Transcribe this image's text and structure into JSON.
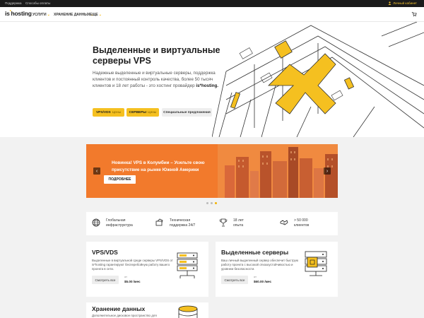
{
  "topbar": {
    "support": "Поддержка",
    "payment": "Способы оплаты",
    "account": "Личный кабинет"
  },
  "nav": {
    "logo_main": "is",
    "logo_sup": "*",
    "logo_rest": "hosting",
    "items": [
      "УСЛУГИ",
      "ХРАНЕНИЕ ДАННЫХ",
      "ЕЩЕ"
    ]
  },
  "hero": {
    "title_line1": "Выделенные и виртуальные",
    "title_line2": "серверы VPS",
    "desc": "Надежные выделенные и виртуальные серверы, поддержка клиентов и постоянный контроль качества, более 50 тысяч клиентов и 18 лет работы - это хостинг провайдер",
    "desc_brand": "is*hosting.",
    "btn_vps": "VPS/VDS",
    "btn_vps_sub": "Цены",
    "btn_servers": "СЕРВЕРЫ",
    "btn_servers_sub": "Цены",
    "btn_special": "Специальные предложения"
  },
  "banner": {
    "title": "Новинка! VPS в Колумбии – Усильте свою присутствие на рынке Южной Америки",
    "button": "ПОДРОБНЕЕ",
    "prev": "‹",
    "next": "›"
  },
  "features": [
    {
      "label1": "Глобальная",
      "label2": "инфраструктура",
      "icon": "globe-icon"
    },
    {
      "label1": "Техническая",
      "label2": "поддержка 24/7",
      "icon": "support-icon"
    },
    {
      "label1": "18 лет",
      "label2": "опыта",
      "icon": "trophy-icon"
    },
    {
      "label1": "> 50 000",
      "label2": "клиентов",
      "icon": "handshake-icon"
    }
  ],
  "cards": {
    "vps": {
      "title": "VPS/VDS",
      "desc": "Выделенные в виртуальной среде серверы VPS/VDS от is*hosting гарантируют бесперебойную работу вашего проекта в сети.",
      "button": "Смотреть все",
      "from": "от",
      "price": "$5.00 /мес"
    },
    "dedicated": {
      "title": "Выделенные серверы",
      "desc": "Ваш личный выделенный сервер обеспечит быструю работу проекта с высокой отказоустойчивостью и уровнем безопасности.",
      "button": "Смотреть все",
      "from": "от",
      "price": "$60.00 /мес"
    },
    "storage": {
      "title": "Хранение данных",
      "desc": "Дополнительное дисковое пространство для"
    }
  },
  "colors": {
    "accent": "#f5c020",
    "banner": "#f27a2c",
    "topbar": "#1b1b1b"
  }
}
